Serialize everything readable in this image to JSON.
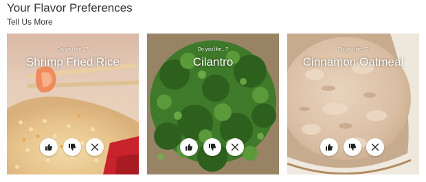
{
  "header": {
    "title": "Your Flavor Preferences",
    "subtitle": "Tell Us More"
  },
  "cards": [
    {
      "prompt": "Do you like...?",
      "name": "Shrimp Fried Rice",
      "image": "shrimp-fried-rice-photo",
      "actions": [
        "thumbs-up-icon",
        "thumbs-down-icon",
        "close-icon"
      ]
    },
    {
      "prompt": "Do you like...?",
      "name": "Cilantro",
      "image": "cilantro-photo",
      "actions": [
        "thumbs-up-icon",
        "thumbs-down-icon",
        "close-icon"
      ]
    },
    {
      "prompt": "Do you like...?",
      "name": "Cinnamon Oatmeal",
      "image": "cinnamon-oatmeal-photo",
      "actions": [
        "thumbs-up-icon",
        "thumbs-down-icon",
        "close-icon"
      ]
    }
  ],
  "colors": {
    "overlay_text": "#ffffff",
    "button_background": "#ffffff",
    "icon": "#222222"
  }
}
